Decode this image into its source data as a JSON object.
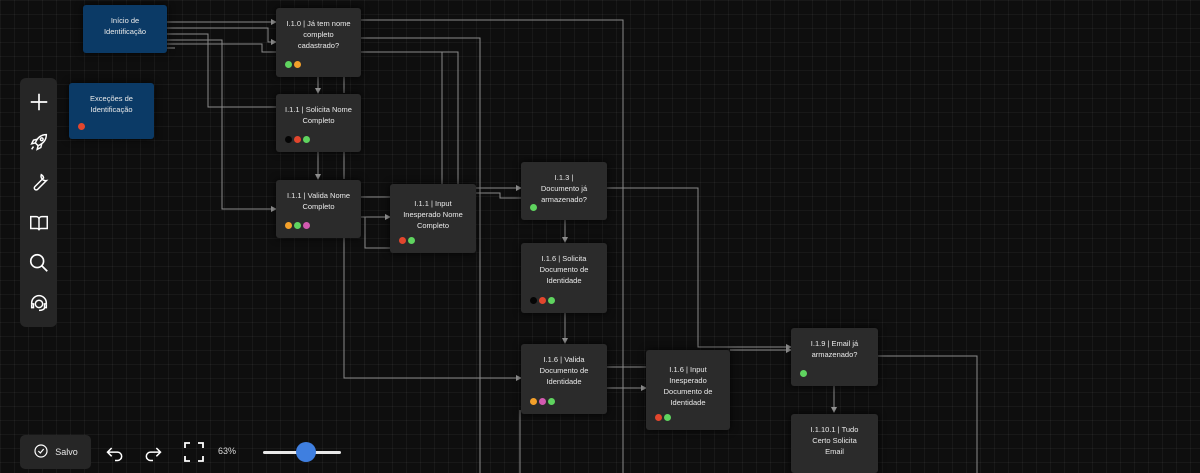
{
  "zoom": {
    "label": "63%",
    "value": 0.55
  },
  "save": {
    "label": "Salvo"
  },
  "toolbar": {
    "icons": [
      "plus-icon",
      "rocket-icon",
      "wrench-icon",
      "book-icon",
      "search-icon",
      "support-icon"
    ]
  },
  "colors": {
    "node_blue": "#0b3a66",
    "node_gray": "#2b2b2b",
    "accent": "#3f7fe0"
  },
  "nodes": {
    "inicio": {
      "label": "Início de Identificação"
    },
    "excecoes": {
      "label": "Exceções de Identificação",
      "dots": [
        "red"
      ]
    },
    "n110": {
      "label": "I.1.0 | Já tem nome completo cadastrado?",
      "dots": [
        "green",
        "orange"
      ]
    },
    "n111s": {
      "label": "I.1.1 | Solicita Nome Completo",
      "dots": [
        "black",
        "red",
        "green"
      ]
    },
    "n111v": {
      "label": "I.1.1 | Valida Nome Completo",
      "dots": [
        "orange",
        "green",
        "pink"
      ]
    },
    "n111i": {
      "label": "I.1.1 | Input Inesperado Nome Completo",
      "dots": [
        "red",
        "green"
      ]
    },
    "n113": {
      "label": "I.1.3 | Documento já armazenado?",
      "dots": [
        "green"
      ]
    },
    "n116s": {
      "label": "I.1.6 | Solicita Documento de Identidade",
      "dots": [
        "black",
        "red",
        "green"
      ]
    },
    "n116v": {
      "label": "I.1.6 | Valida Documento de Identidade",
      "dots": [
        "orange",
        "pink",
        "green"
      ]
    },
    "n116i": {
      "label": "I.1.6 | Input Inesperado Documento de Identidade",
      "dots": [
        "red",
        "green"
      ]
    },
    "n119": {
      "label": "I.1.9 | Email já armazenado?",
      "dots": [
        "green"
      ]
    },
    "n1101": {
      "label": "I.1.10.1 | Tudo Certo Solicita Email",
      "dots": []
    }
  }
}
